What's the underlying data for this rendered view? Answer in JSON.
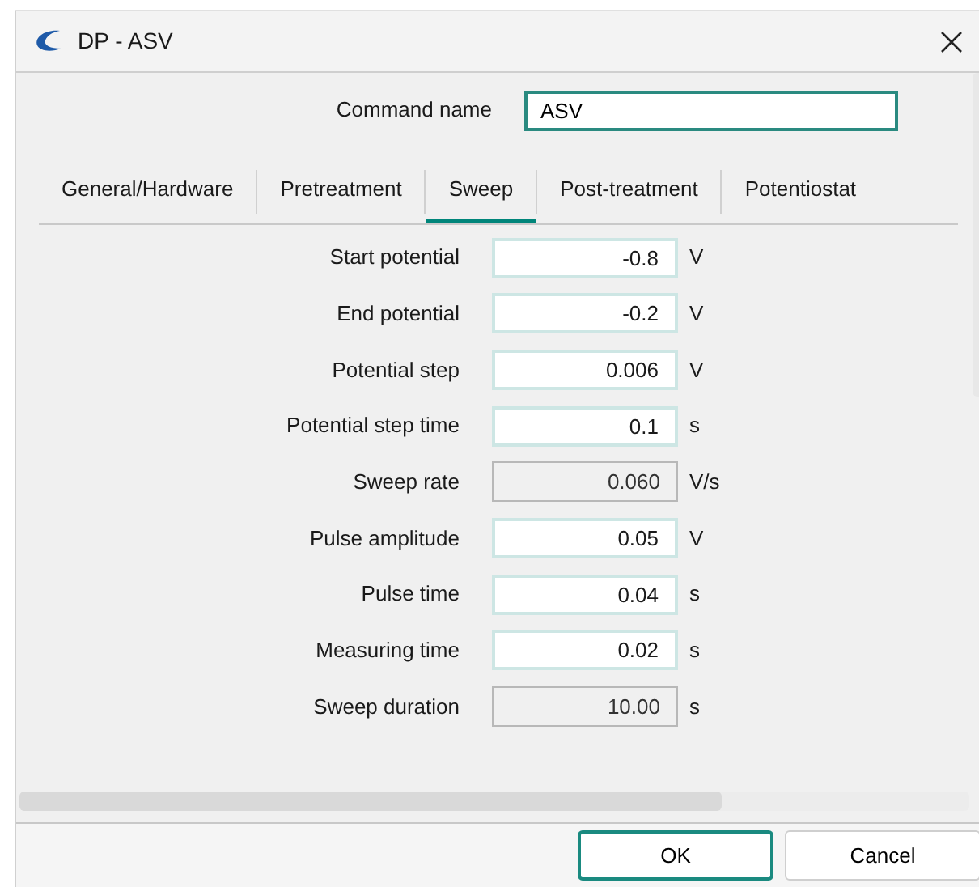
{
  "window": {
    "title": "DP - ASV"
  },
  "command_name": {
    "label": "Command name",
    "value": "ASV"
  },
  "tabs": [
    {
      "label": "General/Hardware",
      "selected": false
    },
    {
      "label": "Pretreatment",
      "selected": false
    },
    {
      "label": "Sweep",
      "selected": true
    },
    {
      "label": "Post-treatment",
      "selected": false
    },
    {
      "label": "Potentiostat",
      "selected": false
    }
  ],
  "fields": [
    {
      "label": "Start potential",
      "value": "-0.8",
      "unit": "V",
      "disabled": false
    },
    {
      "label": "End potential",
      "value": "-0.2",
      "unit": "V",
      "disabled": false
    },
    {
      "label": "Potential step",
      "value": "0.006",
      "unit": "V",
      "disabled": false
    },
    {
      "label": "Potential step time",
      "value": "0.1",
      "unit": "s",
      "disabled": false
    },
    {
      "label": "Sweep rate",
      "value": "0.060",
      "unit": "V/s",
      "disabled": true
    },
    {
      "label": "Pulse amplitude",
      "value": "0.05",
      "unit": "V",
      "disabled": false
    },
    {
      "label": "Pulse time",
      "value": "0.04",
      "unit": "s",
      "disabled": false
    },
    {
      "label": "Measuring time",
      "value": "0.02",
      "unit": "s",
      "disabled": false
    },
    {
      "label": "Sweep duration",
      "value": "10.00",
      "unit": "s",
      "disabled": true
    }
  ],
  "buttons": [
    {
      "label": "OK",
      "default": true
    },
    {
      "label": "Cancel",
      "default": false
    }
  ]
}
